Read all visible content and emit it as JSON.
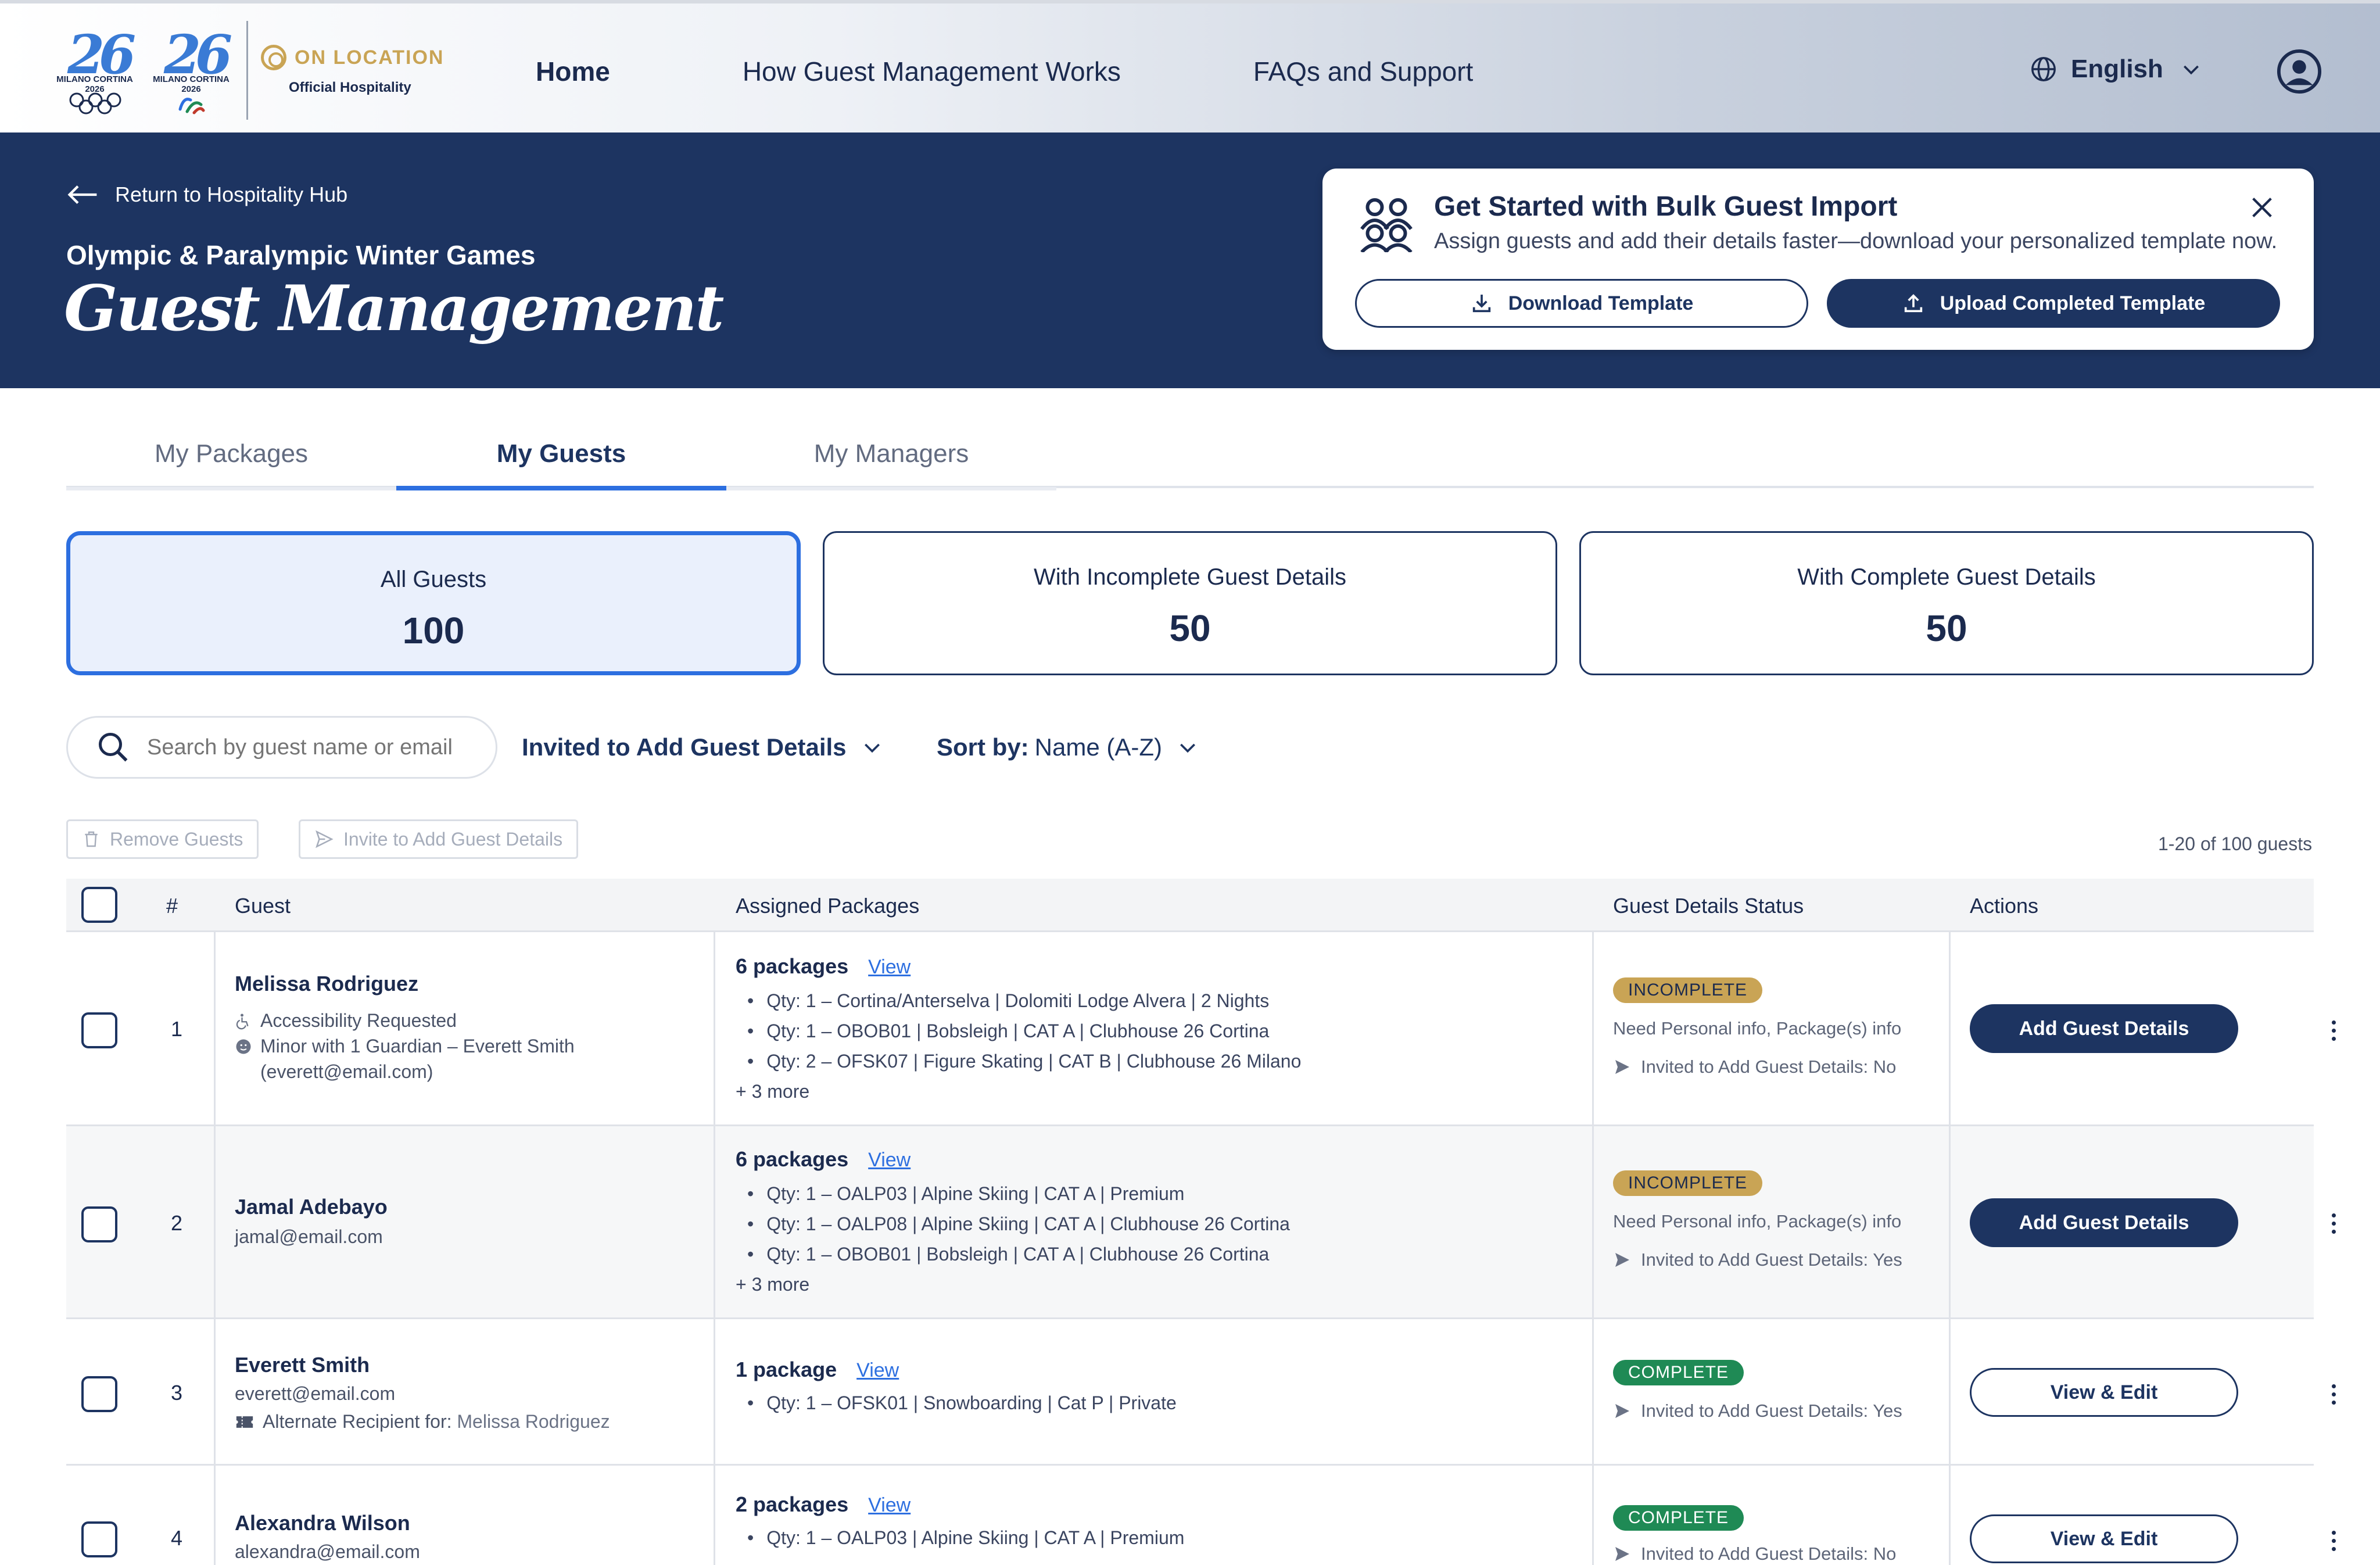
{
  "nav": {
    "brand_main": "MILANO CORTINA 2026",
    "onlocation_label": "ON LOCATION",
    "onlocation_sub": "Official Hospitality",
    "links": [
      "Home",
      "How Guest Management Works",
      "FAQs and Support"
    ],
    "language": "English"
  },
  "hero": {
    "back_label": "Return to Hospitality Hub",
    "event_title": "Olympic & Paralympic Winter Games",
    "page_title": "Guest Management"
  },
  "bulk_import": {
    "title": "Get Started with Bulk Guest Import",
    "description": "Assign guests and add their details faster—download your personalized template now.",
    "download_label": "Download Template",
    "upload_label": "Upload Completed Template"
  },
  "tabs": [
    "My Packages",
    "My Guests",
    "My Managers"
  ],
  "stats": [
    {
      "label": "All Guests",
      "value": "100"
    },
    {
      "label": "With Incomplete Guest Details",
      "value": "50"
    },
    {
      "label": "With Complete Guest Details",
      "value": "50"
    }
  ],
  "filters": {
    "search_placeholder": "Search by guest name or email",
    "status_filter": "Invited to Add Guest Details",
    "sort_prefix": "Sort by:",
    "sort_value": "Name (A-Z)"
  },
  "bulk_actions": {
    "remove_label": "Remove Guests",
    "invite_label": "Invite to Add Guest Details",
    "count_text": "1-20 of 100 guests"
  },
  "table": {
    "headers": [
      "#",
      "Guest",
      "Assigned Packages",
      "Guest Details Status",
      "Actions"
    ],
    "rows": [
      {
        "index": "1",
        "name": "Melissa Rodriguez",
        "accessibility": "Accessibility Requested",
        "minor": "Minor with 1 Guardian – Everett Smith",
        "minor_email": "(everett@email.com)",
        "packages_count": "6 packages",
        "view": "View",
        "packages": [
          "Qty: 1 – Cortina/Anterselva | Dolomiti Lodge Alvera | 2 Nights",
          "Qty: 1 – OBOB01 | Bobsleigh | CAT A | Clubhouse 26 Cortina",
          "Qty: 2 – OFSK07 | Figure Skating | CAT B | Clubhouse 26 Milano"
        ],
        "more": "+ 3 more",
        "status": "INCOMPLETE",
        "need": "Need Personal info, Package(s) info",
        "invited": "Invited to Add Guest Details: No",
        "action": "Add Guest Details"
      },
      {
        "index": "2",
        "name": "Jamal Adebayo",
        "email": "jamal@email.com",
        "packages_count": "6 packages",
        "view": "View",
        "packages": [
          "Qty: 1 – OALP03 | Alpine Skiing | CAT A | Premium",
          "Qty: 1 – OALP08 | Alpine Skiing | CAT A | Clubhouse 26 Cortina",
          "Qty: 1 – OBOB01 | Bobsleigh | CAT A | Clubhouse 26 Cortina"
        ],
        "more": "+ 3 more",
        "status": "INCOMPLETE",
        "need": "Need Personal info, Package(s) info",
        "invited": "Invited to Add Guest Details: Yes",
        "action": "Add Guest Details"
      },
      {
        "index": "3",
        "name": "Everett Smith",
        "email": "everett@email.com",
        "alt_prefix": "Alternate Recipient for:",
        "alt_name": "Melissa Rodriguez",
        "packages_count": "1 package",
        "view": "View",
        "packages": [
          "Qty: 1 – OFSK01 | Snowboarding | Cat P | Private"
        ],
        "status": "COMPLETE",
        "invited": "Invited to Add Guest Details: Yes",
        "action": "View & Edit"
      },
      {
        "index": "4",
        "name": "Alexandra Wilson",
        "email": "alexandra@email.com",
        "packages_count": "2 packages",
        "view": "View",
        "packages": [
          "Qty: 1 – OALP03 | Alpine Skiing | CAT A | Premium"
        ],
        "status": "COMPLETE",
        "invited": "Invited to Add Guest Details: No",
        "action": "View & Edit"
      }
    ]
  },
  "colors": {
    "navy": "#1d3461",
    "accent_blue": "#2d6fe0",
    "gold": "#c9a455",
    "complete_green": "#1f8a55"
  }
}
